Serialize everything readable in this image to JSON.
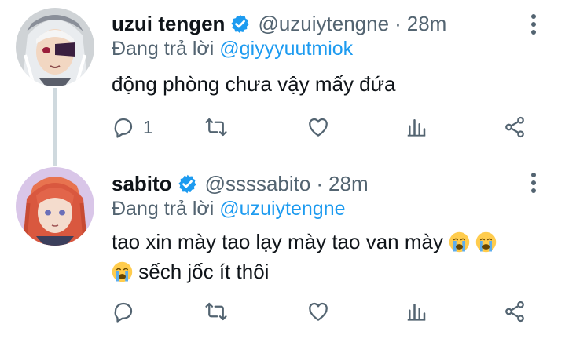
{
  "tweets": [
    {
      "name": "uzui tengen",
      "handle": "@uzuiytengne",
      "separator": "·",
      "time": "28m",
      "replying_prefix": "Đang trả lời",
      "replying_to": "@giyyyuutmiok",
      "body_lines": [
        "động phòng chưa vậy mấy đứa"
      ],
      "reply_count": "1",
      "retweet_count": "",
      "like_count": ""
    },
    {
      "name": "sabito",
      "handle": "@ssssabito",
      "separator": "·",
      "time": "28m",
      "replying_prefix": "Đang trả lời",
      "replying_to": "@uzuiytengne",
      "body_lines": [
        "tao xin mày tao lạy mày tao van mày",
        "sếch jốc ít thôi"
      ],
      "reply_count": "",
      "retweet_count": "",
      "like_count": ""
    }
  ],
  "colors": {
    "text": "#0f1419",
    "secondary": "#536471",
    "accent": "#1d9bf0",
    "thread_line": "#cfd9de"
  },
  "icons": [
    "verified-badge-icon",
    "more-icon",
    "reply-icon",
    "retweet-icon",
    "like-icon",
    "views-icon",
    "share-icon",
    "loudly-crying-emoji"
  ]
}
